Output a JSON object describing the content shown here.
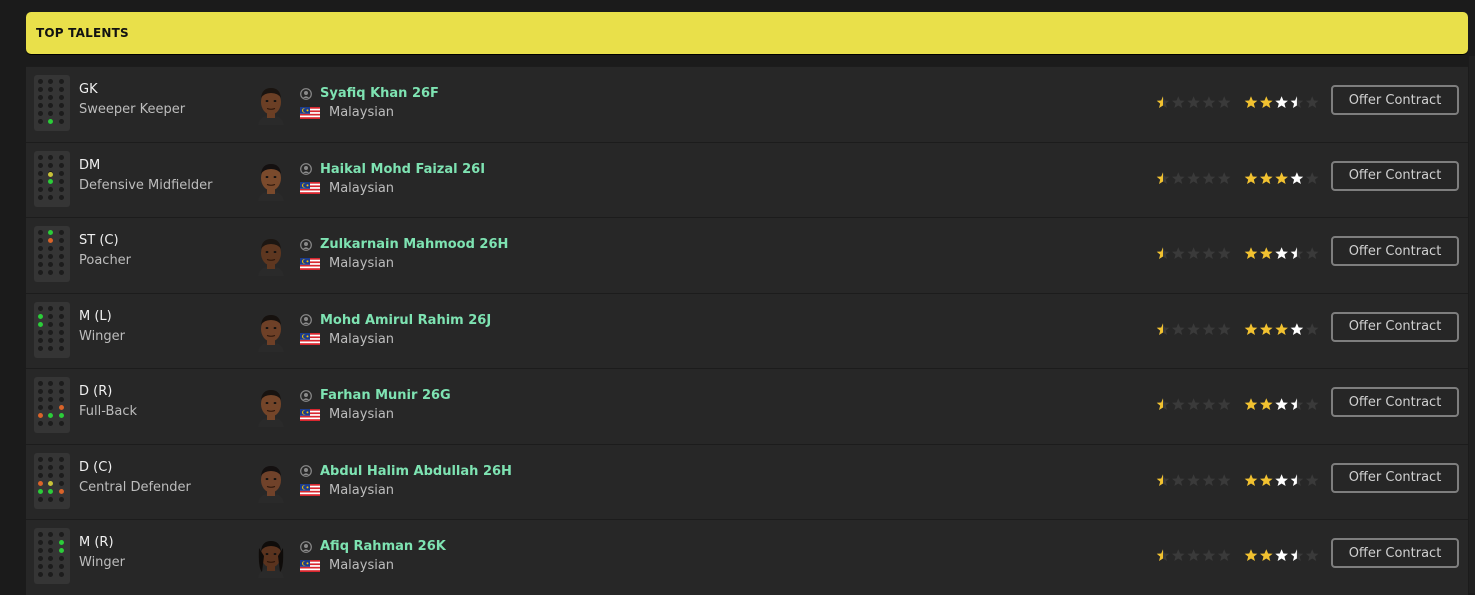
{
  "header": {
    "title": "TOP TALENTS"
  },
  "button_label": "Offer Contract",
  "colors": {
    "accent": "#e9e04a",
    "name": "#7ee3b2",
    "star": "#f2c230"
  },
  "players": [
    {
      "pos": "GK",
      "role": "Sweeper Keeper",
      "name": "Syafiq Khan 26F",
      "nationality": "Malaysian",
      "current_stars": 0.5,
      "potential_stars": 3.5,
      "dots": [
        [
          14,
          44,
          "g"
        ]
      ]
    },
    {
      "pos": "DM",
      "role": "Defensive Midfielder",
      "name": "Haikal Mohd Faizal 26I",
      "nationality": "Malaysian",
      "current_stars": 0.5,
      "potential_stars": 4.0,
      "dots": [
        [
          14,
          21,
          "y"
        ],
        [
          14,
          28,
          "g"
        ]
      ]
    },
    {
      "pos": "ST (C)",
      "role": "Poacher",
      "name": "Zulkarnain Mahmood 26H",
      "nationality": "Malaysian",
      "current_stars": 0.5,
      "potential_stars": 3.5,
      "dots": [
        [
          14,
          4,
          "g"
        ],
        [
          14,
          12,
          "o"
        ]
      ]
    },
    {
      "pos": "M (L)",
      "role": "Winger",
      "name": "Mohd Amirul Rahim 26J",
      "nationality": "Malaysian",
      "current_stars": 0.5,
      "potential_stars": 4.0,
      "dots": [
        [
          4,
          12,
          "g"
        ],
        [
          4,
          20,
          "g"
        ]
      ]
    },
    {
      "pos": "D (R)",
      "role": "Full-Back",
      "name": "Farhan Munir 26G",
      "nationality": "Malaysian",
      "current_stars": 0.5,
      "potential_stars": 3.5,
      "dots": [
        [
          25,
          28,
          "o"
        ],
        [
          4,
          36,
          "o"
        ],
        [
          14,
          36,
          "g"
        ],
        [
          25,
          36,
          "g"
        ]
      ]
    },
    {
      "pos": "D (C)",
      "role": "Central Defender",
      "name": "Abdul Halim Abdullah 26H",
      "nationality": "Malaysian",
      "current_stars": 0.5,
      "potential_stars": 3.5,
      "dots": [
        [
          4,
          28,
          "o"
        ],
        [
          14,
          28,
          "y"
        ],
        [
          4,
          36,
          "g"
        ],
        [
          14,
          36,
          "g"
        ],
        [
          25,
          36,
          "o"
        ]
      ]
    },
    {
      "pos": "M (R)",
      "role": "Winger",
      "name": "Afiq Rahman 26K",
      "nationality": "Malaysian",
      "current_stars": 0.5,
      "potential_stars": 3.5,
      "dots": [
        [
          25,
          12,
          "g"
        ],
        [
          25,
          20,
          "g"
        ]
      ]
    }
  ]
}
